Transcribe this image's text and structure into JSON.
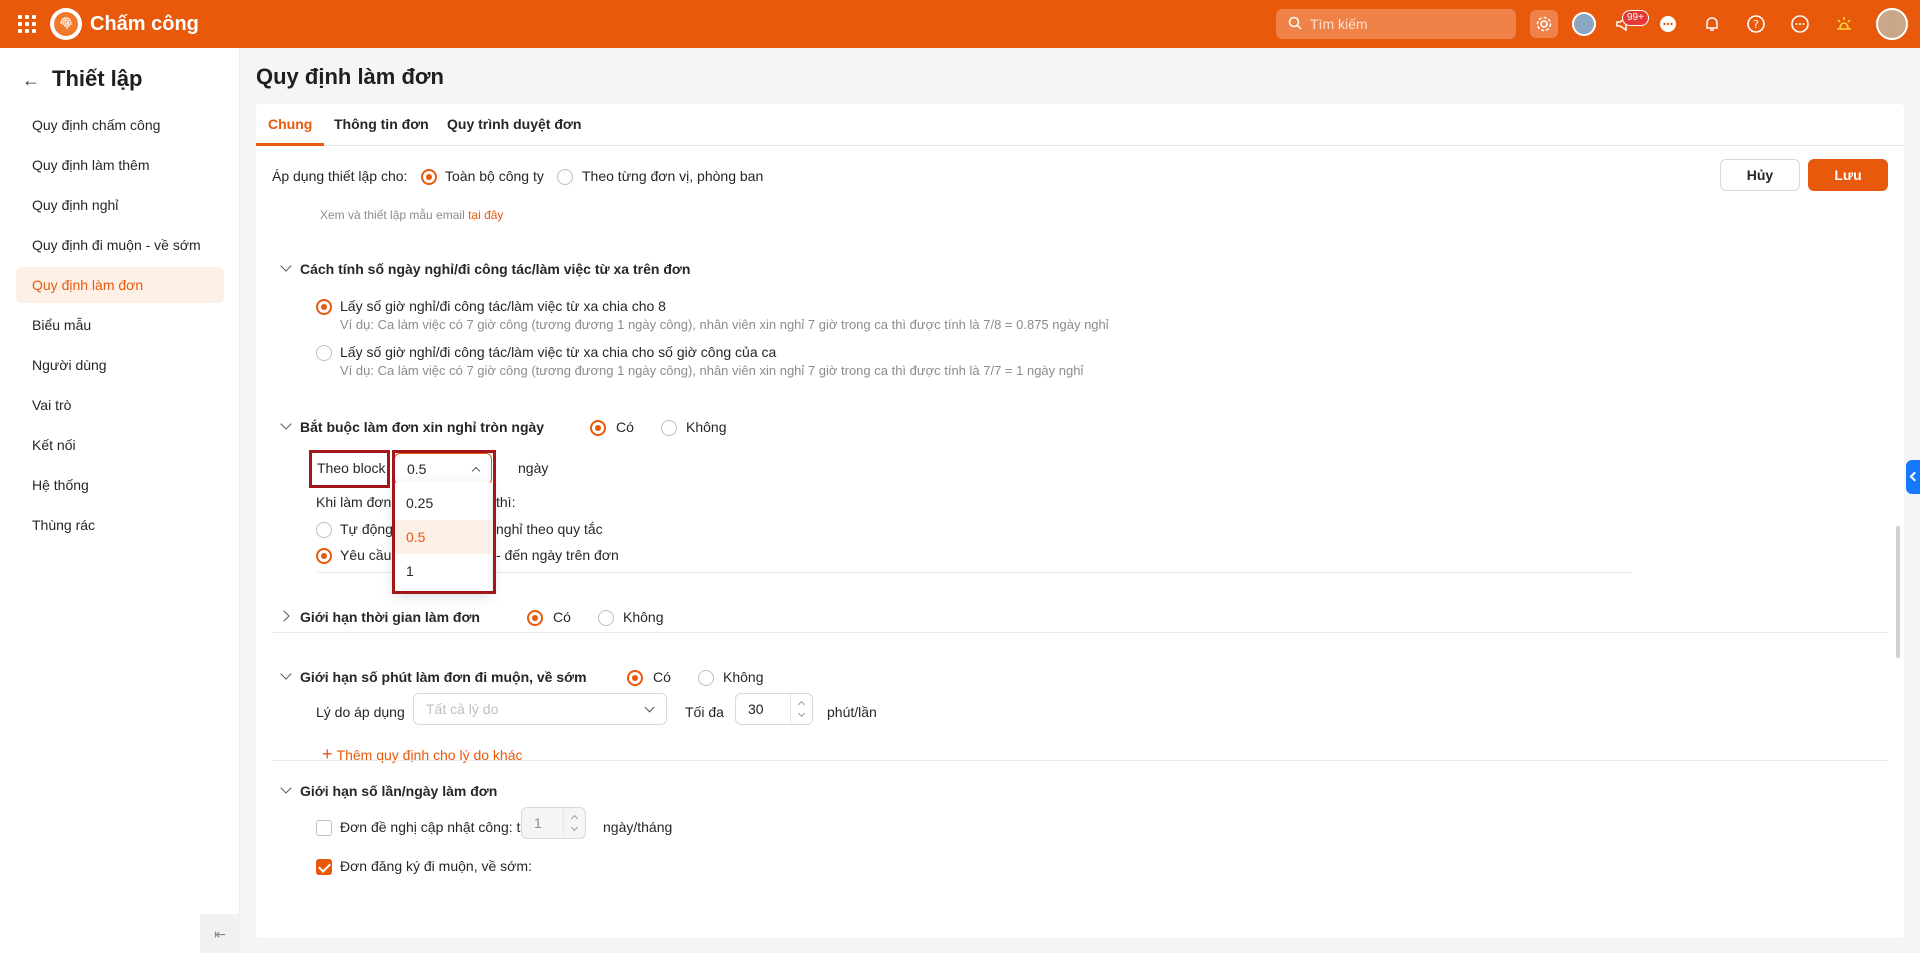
{
  "topbar": {
    "app_name": "Chấm công",
    "search_placeholder": "Tìm kiếm",
    "notification_count": "99+"
  },
  "sidebar": {
    "title": "Thiết lập",
    "items": [
      {
        "label": "Quy định chấm công"
      },
      {
        "label": "Quy định làm thêm"
      },
      {
        "label": "Quy định nghỉ"
      },
      {
        "label": "Quy định đi muộn - về sớm"
      },
      {
        "label": "Quy định làm đơn"
      },
      {
        "label": "Biểu mẫu"
      },
      {
        "label": "Người dùng"
      },
      {
        "label": "Vai trò"
      },
      {
        "label": "Kết nối"
      },
      {
        "label": "Hệ thống"
      },
      {
        "label": "Thùng rác"
      }
    ],
    "active_index": 4
  },
  "main": {
    "title": "Quy định làm đơn",
    "tabs": [
      {
        "label": "Chung"
      },
      {
        "label": "Thông tin đơn"
      },
      {
        "label": "Quy trình duyệt đơn"
      }
    ],
    "apply_label": "Áp dụng thiết lập cho:",
    "apply_options": [
      "Toàn bộ công ty",
      "Theo từng đơn vị, phòng ban"
    ],
    "cancel_label": "Hủy",
    "save_label": "Lưu",
    "email_note_prefix": "Xem và thiết lập mẫu email",
    "email_note_link": "tại đây",
    "calc_section": {
      "title": "Cách tính số ngày nghỉ/đi công tác/làm việc từ xa trên đơn",
      "option1": "Lấy số giờ nghỉ/đi công tác/làm việc từ xa chia cho 8",
      "option1_example": "Ví dụ: Ca làm việc có 7 giờ công (tương đương 1 ngày công), nhân viên xin nghỉ 7 giờ trong ca thì được tính là 7/8 = 0.875 ngày nghỉ",
      "option2": "Lấy số giờ nghỉ/đi công tác/làm việc từ xa chia cho số giờ công của ca",
      "option2_example": "Ví dụ: Ca làm việc có 7 giờ công (tương đương 1 ngày công), nhân viên xin nghỉ 7 giờ trong ca thì được tính là 7/7 = 1 ngày nghỉ"
    },
    "fullday_section": {
      "title": "Bắt buộc làm đơn xin nghỉ tròn ngày",
      "yes": "Có",
      "no": "Không",
      "block_label": "Theo block",
      "block_value": "0.5",
      "unit": "ngày",
      "when_label_start": "Khi làm đơn",
      "when_label_end": "thì:",
      "auto_option_start": "Tự động",
      "auto_option_end": "nghỉ theo quy tắc",
      "require_option_start": "Yêu cầu",
      "require_option_end": "- đến ngày trên đơn",
      "dropdown_options": [
        "0.25",
        "0.5",
        "1"
      ]
    },
    "time_limit_section": {
      "title": "Giới hạn thời gian làm đơn",
      "yes": "Có",
      "no": "Không"
    },
    "late_section": {
      "title": "Giới hạn số phút làm đơn đi muộn, về sớm",
      "yes": "Có",
      "no": "Không",
      "reason_label": "Lý do áp dụng",
      "reason_placeholder": "Tất cả lý do",
      "max_label": "Tối đa",
      "max_value": "30",
      "unit": "phút/lần",
      "add_rule": "Thêm quy định cho lý do khác"
    },
    "count_section": {
      "title": "Giới hạn số lần/ngày làm đơn",
      "item1_label": "Đơn đề nghị cập nhật công: tối đa",
      "item1_value": "1",
      "item1_unit": "ngày/tháng",
      "item2_label": "Đơn đăng ký đi muộn, về sớm:"
    }
  }
}
